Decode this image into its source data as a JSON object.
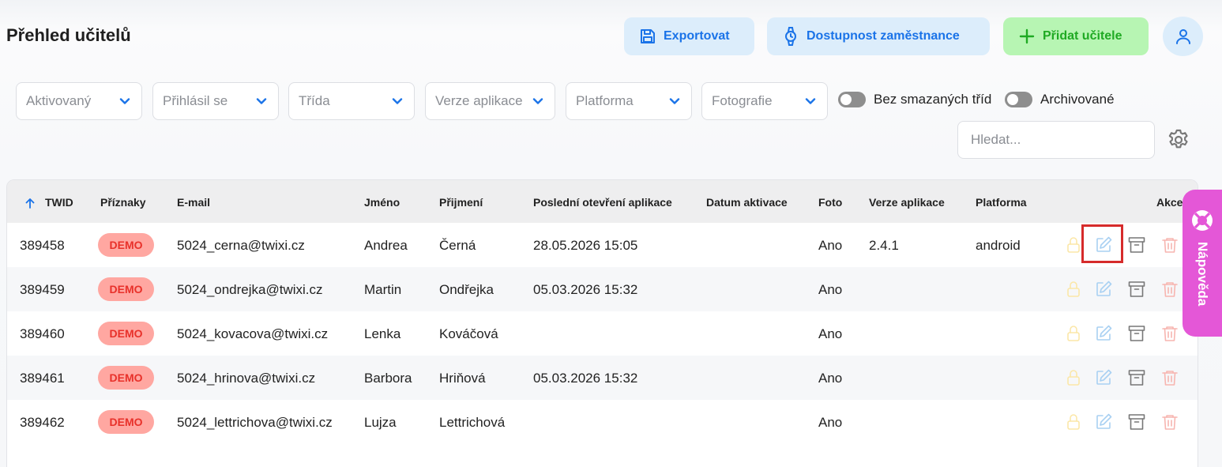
{
  "header": {
    "title": "Přehled učitelů",
    "export_label": "Exportovat",
    "availability_label": "Dostupnost zaměstnance",
    "add_label": "Přidat učitele"
  },
  "filters": [
    {
      "label": "Aktivovaný"
    },
    {
      "label": "Přihlásil se"
    },
    {
      "label": "Třída"
    },
    {
      "label": "Verze aplikace"
    },
    {
      "label": "Platforma"
    },
    {
      "label": "Fotografie"
    }
  ],
  "toggles": {
    "no_deleted_classes": "Bez smazaných tříd",
    "archived": "Archivované"
  },
  "search": {
    "placeholder": "Hledat...",
    "value": ""
  },
  "table": {
    "columns": {
      "twid": "TWID",
      "flags": "Příznaky",
      "email": "E-mail",
      "first_name": "Jméno",
      "last_name": "Přijmení",
      "last_open": "Poslední otevření aplikace",
      "activation": "Datum aktivace",
      "photo": "Foto",
      "app_version": "Verze aplikace",
      "platform": "Platforma",
      "actions": "Akce"
    },
    "rows": [
      {
        "twid": "389458",
        "flag": "DEMO",
        "email": "5024_cerna@twixi.cz",
        "first_name": "Andrea",
        "last_name": "Černá",
        "last_open": "28.05.2026 15:05",
        "activation": "",
        "photo": "Ano",
        "app_version": "2.4.1",
        "platform": "android"
      },
      {
        "twid": "389459",
        "flag": "DEMO",
        "email": "5024_ondrejka@twixi.cz",
        "first_name": "Martin",
        "last_name": "Ondřejka",
        "last_open": "05.03.2026 15:32",
        "activation": "",
        "photo": "Ano",
        "app_version": "",
        "platform": ""
      },
      {
        "twid": "389460",
        "flag": "DEMO",
        "email": "5024_kovacova@twixi.cz",
        "first_name": "Lenka",
        "last_name": "Kováčová",
        "last_open": "",
        "activation": "",
        "photo": "Ano",
        "app_version": "",
        "platform": ""
      },
      {
        "twid": "389461",
        "flag": "DEMO",
        "email": "5024_hrinova@twixi.cz",
        "first_name": "Barbora",
        "last_name": "Hriňová",
        "last_open": "05.03.2026 15:32",
        "activation": "",
        "photo": "Ano",
        "app_version": "",
        "platform": ""
      },
      {
        "twid": "389462",
        "flag": "DEMO",
        "email": "5024_lettrichova@twixi.cz",
        "first_name": "Lujza",
        "last_name": "Lettrichová",
        "last_open": "",
        "activation": "",
        "photo": "Ano",
        "app_version": "",
        "platform": ""
      }
    ]
  },
  "help": {
    "label": "Nápověda"
  },
  "icons": {
    "export": "save-icon",
    "availability": "watch-icon",
    "add": "plus-icon",
    "profile": "user-icon",
    "settings": "gear-icon",
    "sort": "arrow-up-icon",
    "row_actions": [
      "lock-icon",
      "edit-icon",
      "archive-icon",
      "trash-icon"
    ],
    "help": "lifebuoy-icon"
  },
  "colors": {
    "accent_blue": "#1a73e8",
    "add_green": "#1faa23",
    "demo_badge": "#ffa7a1",
    "demo_text": "#e8312a",
    "help_tab": "#e457d7",
    "highlight": "#d62b2b"
  }
}
